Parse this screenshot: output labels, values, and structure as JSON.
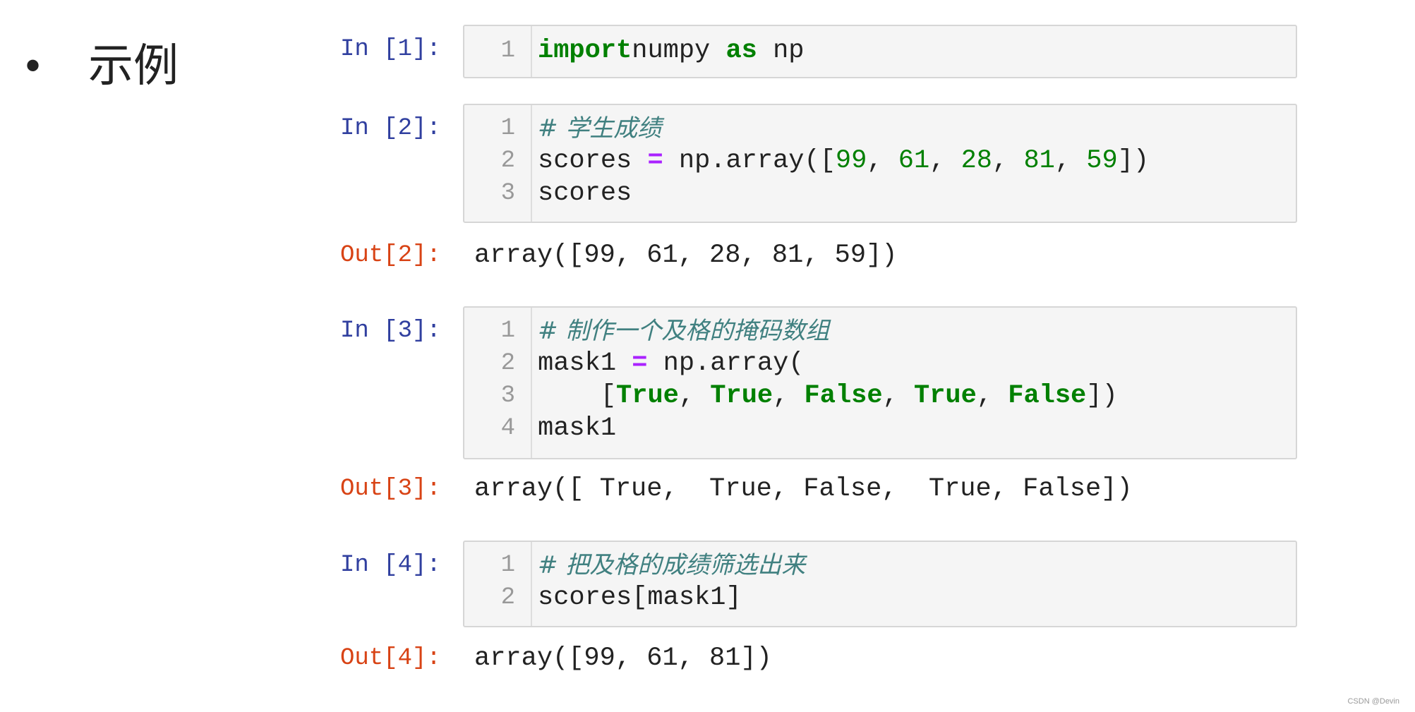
{
  "heading": {
    "bullet": "•",
    "title": "示例"
  },
  "cells": [
    {
      "prompt": "In [1]:",
      "lines": [
        {
          "n": "1",
          "tokens": [
            [
              "kw",
              "import"
            ],
            [
              "",
              "numpy "
            ],
            [
              "kw",
              "as"
            ],
            [
              "",
              " np"
            ]
          ]
        }
      ]
    },
    {
      "prompt": "In [2]:",
      "lines": [
        {
          "n": "1",
          "tokens": [
            [
              "cm",
              "# 学生成绩"
            ]
          ]
        },
        {
          "n": "2",
          "tokens": [
            [
              "",
              "scores "
            ],
            [
              "op",
              "="
            ],
            [
              "",
              " np.array(["
            ],
            [
              "num",
              "99"
            ],
            [
              "",
              ", "
            ],
            [
              "num",
              "61"
            ],
            [
              "",
              ", "
            ],
            [
              "num",
              "28"
            ],
            [
              "",
              ", "
            ],
            [
              "num",
              "81"
            ],
            [
              "",
              ", "
            ],
            [
              "num",
              "59"
            ],
            [
              "",
              "])"
            ]
          ]
        },
        {
          "n": "3",
          "tokens": [
            [
              "",
              "scores"
            ]
          ]
        }
      ],
      "out_prompt": "Out[2]:",
      "output": "array([99, 61, 28, 81, 59])"
    },
    {
      "prompt": "In [3]:",
      "lines": [
        {
          "n": "1",
          "tokens": [
            [
              "cm",
              "# 制作一个及格的掩码数组"
            ]
          ]
        },
        {
          "n": "2",
          "tokens": [
            [
              "",
              "mask1 "
            ],
            [
              "op",
              "="
            ],
            [
              "",
              " np.array("
            ]
          ]
        },
        {
          "n": "3",
          "tokens": [
            [
              "",
              "    ["
            ],
            [
              "kw",
              "True"
            ],
            [
              "",
              ", "
            ],
            [
              "kw",
              "True"
            ],
            [
              "",
              ", "
            ],
            [
              "kw",
              "False"
            ],
            [
              "",
              ", "
            ],
            [
              "kw",
              "True"
            ],
            [
              "",
              ", "
            ],
            [
              "kw",
              "False"
            ],
            [
              "",
              "])"
            ]
          ]
        },
        {
          "n": "4",
          "tokens": [
            [
              "",
              "mask1"
            ]
          ]
        }
      ],
      "out_prompt": "Out[3]:",
      "output": "array([ True,  True, False,  True, False])"
    },
    {
      "prompt": "In [4]:",
      "lines": [
        {
          "n": "1",
          "tokens": [
            [
              "cm",
              "# 把及格的成绩筛选出来"
            ]
          ]
        },
        {
          "n": "2",
          "tokens": [
            [
              "",
              "scores[mask1]"
            ]
          ]
        }
      ],
      "out_prompt": "Out[4]:",
      "output": "array([99, 61, 81])"
    }
  ],
  "watermark": "CSDN @Devin",
  "colors": {
    "in_prompt": "#303f9f",
    "out_prompt": "#d84315",
    "keyword": "#008000",
    "comment": "#408080",
    "operator": "#aa22ff",
    "cell_bg": "#f5f5f5"
  }
}
